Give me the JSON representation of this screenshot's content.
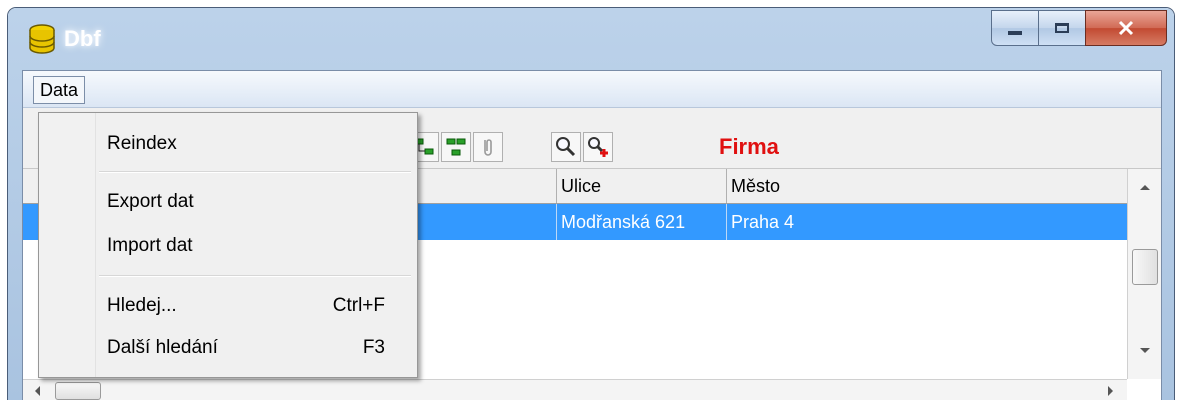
{
  "window": {
    "title": "Dbf",
    "app_icon": "database-icon"
  },
  "menubar": {
    "data_label": "Data"
  },
  "toolbar": {
    "firma_label": "Firma",
    "firma_color": "#e01010"
  },
  "grid": {
    "columns": [
      "Ulice",
      "Město"
    ],
    "selected_row": {
      "ulice": "Modřanská 621",
      "mesto": "Praha 4"
    },
    "selection_color": "#3399ff"
  },
  "menu": {
    "reindex": "Reindex",
    "export": "Export dat",
    "import": "Import dat",
    "search": "Hledej...",
    "search_shortcut": "Ctrl+F",
    "next_search": "Další hledání",
    "next_search_shortcut": "F3"
  }
}
